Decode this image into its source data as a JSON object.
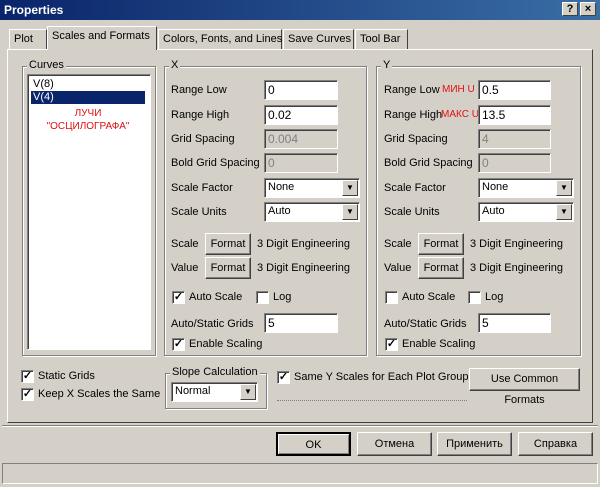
{
  "window": {
    "title": "Properties",
    "help_label": "?",
    "close_label": "×"
  },
  "tabs": [
    {
      "label": "Plot"
    },
    {
      "label": "Scales and Formats"
    },
    {
      "label": "Colors, Fonts, and Lines"
    },
    {
      "label": "Save Curves"
    },
    {
      "label": "Tool Bar"
    }
  ],
  "curves": {
    "label": "Curves",
    "items": [
      "V(8)",
      "V(4)"
    ],
    "annotation_line1": "ЛУЧИ",
    "annotation_line2": "\"ОСЦИЛОГРАФА\""
  },
  "x": {
    "label": "X",
    "range_low_label": "Range Low",
    "range_low": "0",
    "range_high_label": "Range High",
    "range_high": "0.02",
    "grid_spacing_label": "Grid Spacing",
    "grid_spacing": "0.004",
    "bold_grid_label": "Bold Grid Spacing",
    "bold_grid": "0",
    "scale_factor_label": "Scale Factor",
    "scale_factor": "None",
    "scale_units_label": "Scale Units",
    "scale_units": "Auto",
    "scale_label": "Scale",
    "scale_format_btn": "Format",
    "scale_format": "3 Digit Engineering",
    "value_label": "Value",
    "value_format_btn": "Format",
    "value_format": "3 Digit Engineering",
    "auto_scale_label": "Auto Scale",
    "auto_scale_mark": "✓",
    "log_label": "Log",
    "log_mark": "",
    "auto_static_label": "Auto/Static Grids",
    "auto_static": "5",
    "enable_scaling_label": "Enable Scaling",
    "enable_scaling_mark": "✓"
  },
  "y": {
    "label": "Y",
    "range_low_label": "Range Low",
    "range_low_note": "МИН U",
    "range_low": "0.5",
    "range_high_label": "Range High",
    "range_high_note": "МАКС U",
    "range_high": "13.5",
    "grid_spacing_label": "Grid Spacing",
    "grid_spacing": "4",
    "bold_grid_label": "Bold Grid Spacing",
    "bold_grid": "0",
    "scale_factor_label": "Scale Factor",
    "scale_factor": "None",
    "scale_units_label": "Scale Units",
    "scale_units": "Auto",
    "scale_label": "Scale",
    "scale_format_btn": "Format",
    "scale_format": "3 Digit Engineering",
    "value_label": "Value",
    "value_format_btn": "Format",
    "value_format": "3 Digit Engineering",
    "auto_scale_label": "Auto Scale",
    "auto_scale_mark": "",
    "log_label": "Log",
    "log_mark": "",
    "auto_static_label": "Auto/Static Grids",
    "auto_static": "5",
    "enable_scaling_label": "Enable Scaling",
    "enable_scaling_mark": "✓"
  },
  "bottom": {
    "static_grids_label": "Static Grids",
    "static_grids_mark": "✓",
    "keep_x_label": "Keep X Scales the Same",
    "keep_x_mark": "✓",
    "slope_label": "Slope Calculation",
    "slope_value": "Normal",
    "same_y_label": "Same Y Scales for Each Plot Group",
    "same_y_mark": "✓",
    "common_formats": "Use Common Formats"
  },
  "buttons": {
    "ok": "OK",
    "cancel": "Отмена",
    "apply": "Применить",
    "help": "Справка"
  },
  "icons": {
    "dropdown": "▼"
  }
}
